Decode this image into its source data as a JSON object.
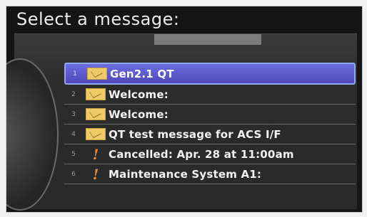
{
  "header": {
    "title": "Select a message:"
  },
  "messages": [
    {
      "number": "1",
      "icon": "envelope-icon",
      "label": "Gen2.1 QT",
      "selected": true
    },
    {
      "number": "2",
      "icon": "envelope-icon",
      "label": "Welcome:"
    },
    {
      "number": "3",
      "icon": "envelope-icon",
      "label": "Welcome:"
    },
    {
      "number": "4",
      "icon": "envelope-icon",
      "label": "QT test message for ACS I/F"
    },
    {
      "number": "5",
      "icon": "alert-icon",
      "label": "Cancelled: Apr. 28 at 11:00am"
    },
    {
      "number": "6",
      "icon": "alert-icon",
      "label": "Maintenance System A1:"
    }
  ],
  "colors": {
    "selected_row": "#5a55cc",
    "envelope": "#f0c968",
    "alert": "#e98a3a",
    "background": "#2b2b2b"
  }
}
